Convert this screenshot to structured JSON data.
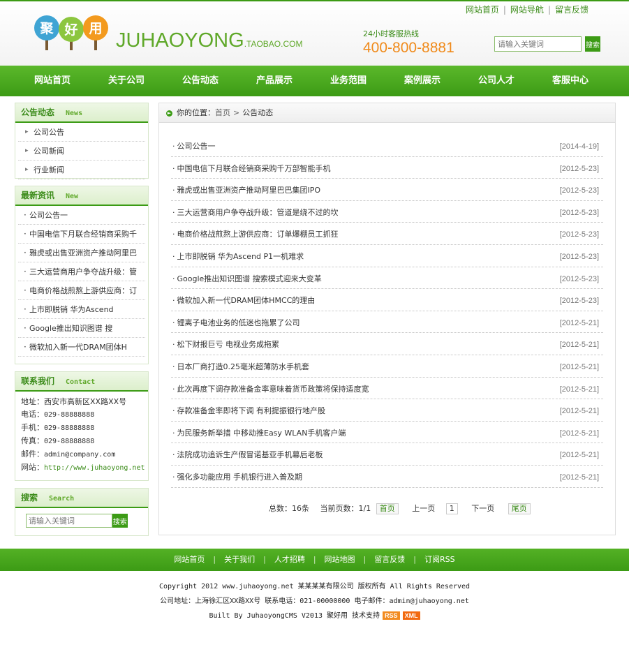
{
  "header": {
    "logo_chars": [
      "聚",
      "好",
      "用"
    ],
    "brand": "JUHAOYONG",
    "brand_suffix": ".TAOBAO.COM",
    "toplinks": [
      "网站首页",
      "网站导航",
      "留言反馈"
    ],
    "hotline_label": "24小时客服热线",
    "hotline_number": "400-800-8881",
    "search_placeholder": "请输入关键词",
    "search_button": "搜索"
  },
  "nav": [
    "网站首页",
    "关于公司",
    "公告动态",
    "产品展示",
    "业务范围",
    "案例展示",
    "公司人才",
    "客服中心"
  ],
  "sidebar": {
    "notice": {
      "title": "公告动态",
      "title_en": "News",
      "items": [
        "公司公告",
        "公司新闻",
        "行业新闻"
      ]
    },
    "latest": {
      "title": "最新资讯",
      "title_en": "New",
      "items": [
        "公司公告一",
        "中国电信下月联合经销商采购千",
        "雅虎或出售亚洲资产推动阿里巴",
        "三大运营商用户争夺战升级：管",
        "电商价格战煎熬上游供应商：订",
        "上市即脱销 华为Ascend",
        "Google推出知识图谱 搜",
        "微软加入新一代DRAM团体H"
      ]
    },
    "contact": {
      "title": "联系我们",
      "title_en": "Contact",
      "lines": [
        {
          "label": "地址：",
          "value": "西安市高新区XX路XX号"
        },
        {
          "label": "电话：",
          "value": "029-88888888"
        },
        {
          "label": "手机：",
          "value": "029-88888888"
        },
        {
          "label": "传真：",
          "value": "029-88888888"
        },
        {
          "label": "邮件：",
          "value": "admin@company.com"
        },
        {
          "label": "网站：",
          "value": "http://www.juhaoyong.net"
        }
      ]
    },
    "search": {
      "title": "搜索",
      "title_en": "Search",
      "placeholder": "请输入关键词",
      "button": "搜索"
    }
  },
  "breadcrumb": {
    "label": "你的位置：",
    "home": "首页",
    "current": "公告动态"
  },
  "articles": [
    {
      "title": "公司公告一",
      "date": "[2014-4-19]"
    },
    {
      "title": "中国电信下月联合经销商采购千万部智能手机",
      "date": "[2012-5-23]"
    },
    {
      "title": "雅虎或出售亚洲资产推动阿里巴巴集团IPO",
      "date": "[2012-5-23]"
    },
    {
      "title": "三大运营商用户争夺战升级：管道是绕不过的坎",
      "date": "[2012-5-23]"
    },
    {
      "title": "电商价格战煎熬上游供应商：订单爆棚员工抓狂",
      "date": "[2012-5-23]"
    },
    {
      "title": "上市即脱销 华为Ascend P1一机难求",
      "date": "[2012-5-23]"
    },
    {
      "title": "Google推出知识图谱 搜索模式迎来大变革",
      "date": "[2012-5-23]"
    },
    {
      "title": "微软加入新一代DRAM团体HMCC的理由",
      "date": "[2012-5-23]"
    },
    {
      "title": "锂离子电池业务的低迷也拖累了公司",
      "date": "[2012-5-21]"
    },
    {
      "title": "松下财报巨亏 电视业务成拖累",
      "date": "[2012-5-21]"
    },
    {
      "title": "日本厂商打造0.25毫米超薄防水手机套",
      "date": "[2012-5-21]"
    },
    {
      "title": "此次再度下调存款准备金率意味着货币政策将保持适度宽",
      "date": "[2012-5-21]"
    },
    {
      "title": "存款准备金率即将下调 有利提振银行地产股",
      "date": "[2012-5-21]"
    },
    {
      "title": "为民服务新举措 中移动推Easy WLAN手机客户端",
      "date": "[2012-5-21]"
    },
    {
      "title": "法院成功追诉生产假冒诺基亚手机幕后老板",
      "date": "[2012-5-21]"
    },
    {
      "title": "强化多功能应用 手机银行进入普及期",
      "date": "[2012-5-21]"
    }
  ],
  "pager": {
    "total": "总数：16条",
    "page": "当前页数：1/1",
    "first": "首页",
    "prev": "上一页",
    "current": "1",
    "next": "下一页",
    "last": "尾页"
  },
  "footer": {
    "links": [
      "网站首页",
      "关于我们",
      "人才招聘",
      "网站地图",
      "留言反馈",
      "订阅RSS"
    ],
    "copyright": "Copyright 2012 www.juhaoyong.net 某某某某有限公司 版权所有 All Rights Reserved",
    "address": "公司地址：上海徐汇区XX路XX号 联系电话：021-00000000 电子邮件：admin@juhaoyong.net",
    "built": "Built By JuhaoyongCMS V2013 聚好用 技术支持",
    "tags": [
      "RSS",
      "XML"
    ]
  },
  "colors": {
    "green": "#3c9b15",
    "orange": "#f08a1a"
  }
}
